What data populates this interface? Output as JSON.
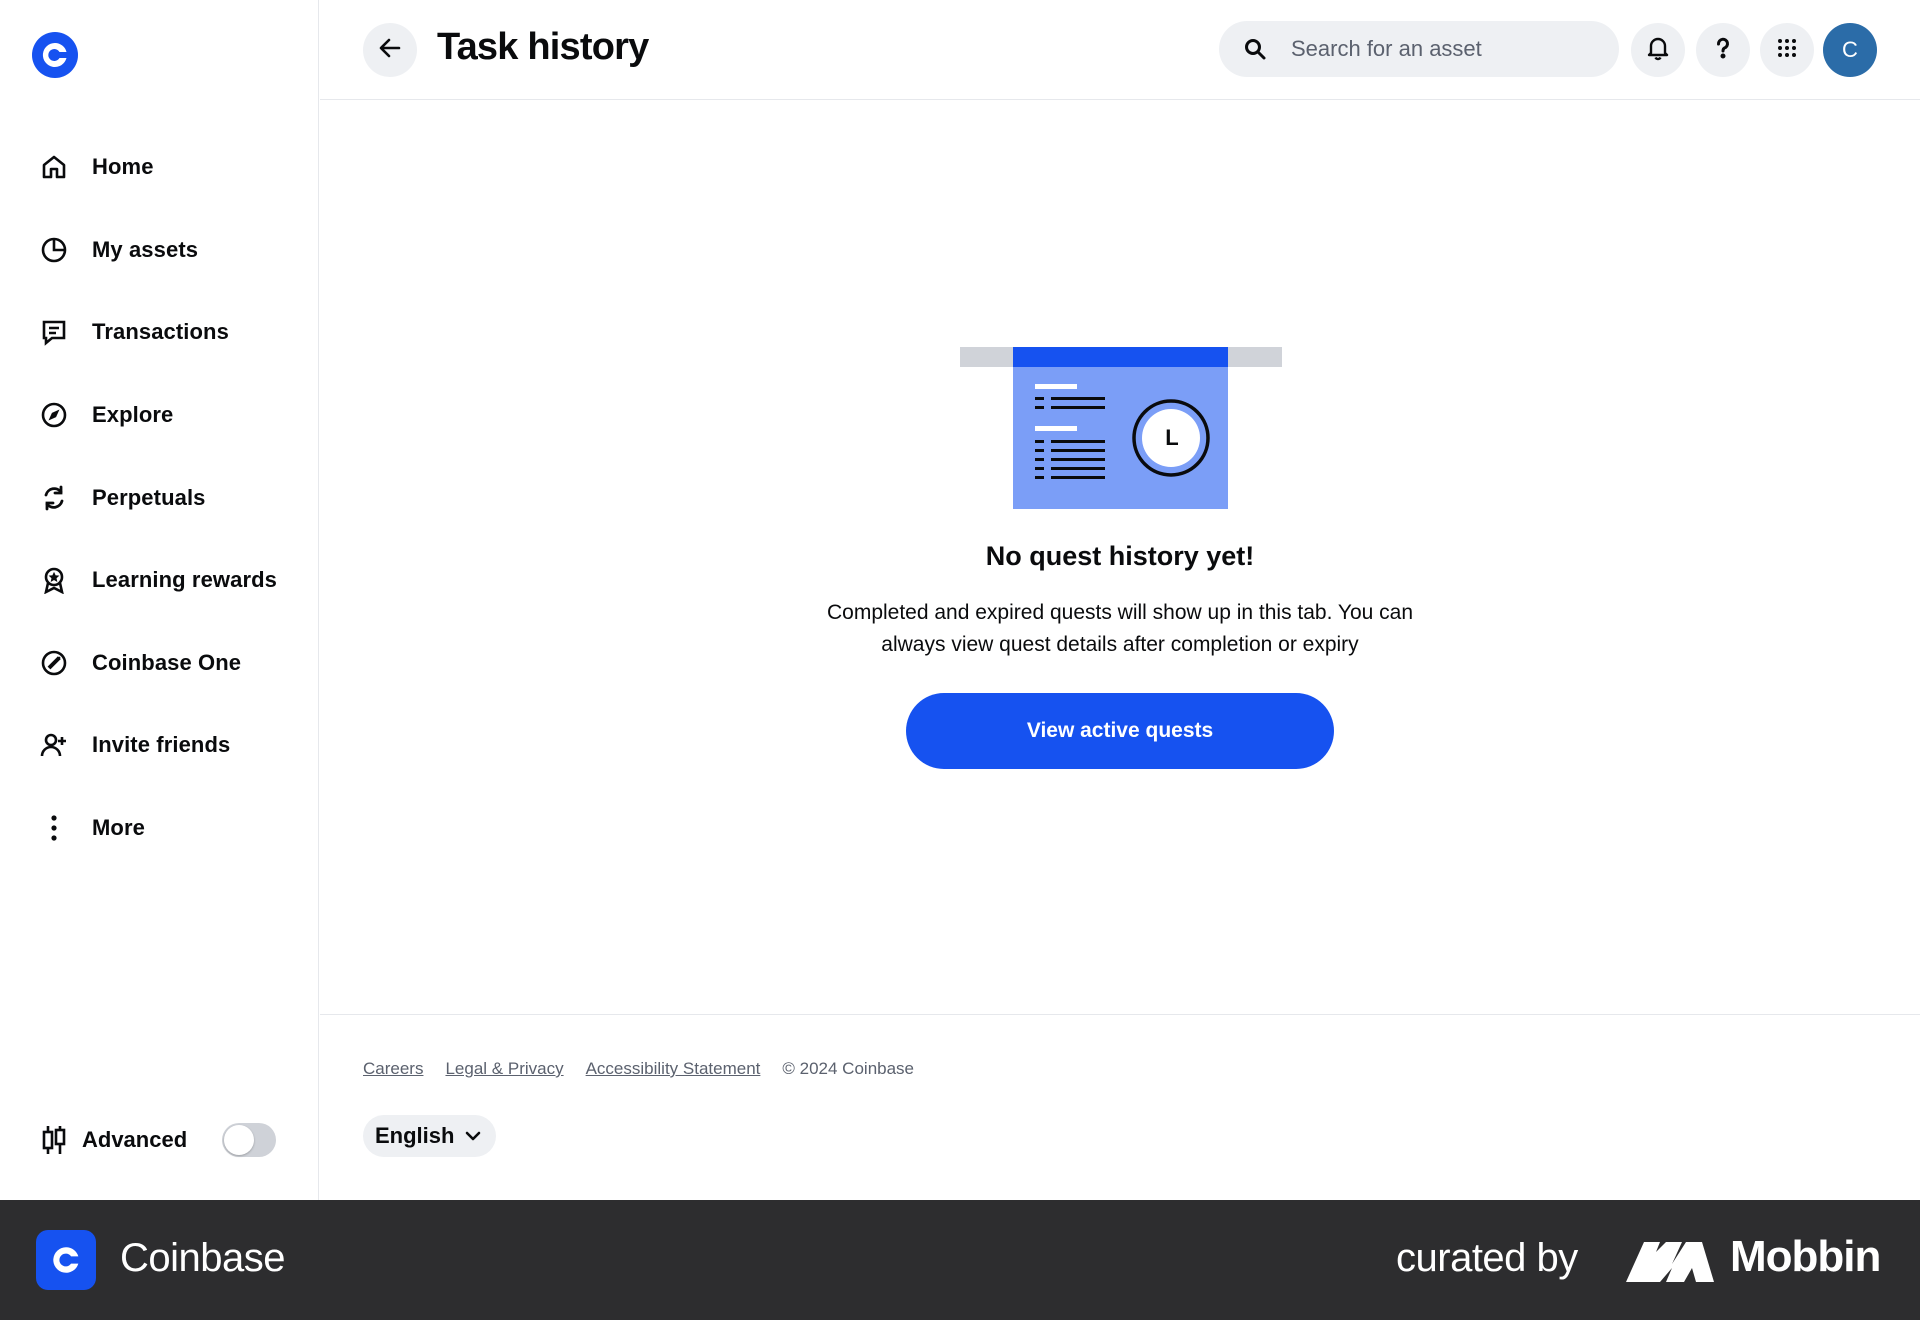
{
  "app": {
    "name": "Coinbase",
    "brand_color": "#1652f0"
  },
  "sidebar": {
    "items": [
      {
        "label": "Home",
        "icon": "home-icon"
      },
      {
        "label": "My assets",
        "icon": "pie-chart-icon"
      },
      {
        "label": "Transactions",
        "icon": "receipt-icon"
      },
      {
        "label": "Explore",
        "icon": "compass-icon"
      },
      {
        "label": "Perpetuals",
        "icon": "refresh-icon"
      },
      {
        "label": "Learning rewards",
        "icon": "reward-badge-icon"
      },
      {
        "label": "Coinbase One",
        "icon": "coinbase-one-icon"
      },
      {
        "label": "Invite friends",
        "icon": "add-user-icon"
      },
      {
        "label": "More",
        "icon": "more-vertical-icon"
      }
    ],
    "advanced": {
      "label": "Advanced",
      "enabled": false
    }
  },
  "header": {
    "title": "Task history",
    "search": {
      "placeholder": "Search for an asset"
    },
    "avatar_initial": "C"
  },
  "main": {
    "illustration": {
      "clock_letter": "L"
    },
    "empty_title": "No quest history yet!",
    "empty_description": "Completed and expired quests will show up in this tab. You can always view quest details after completion or expiry",
    "cta_label": "View active quests"
  },
  "footer": {
    "links": [
      "Careers",
      "Legal & Privacy",
      "Accessibility Statement"
    ],
    "copyright": "© 2024 Coinbase",
    "language": "English"
  },
  "banner": {
    "app_name": "Coinbase",
    "curated_by": "curated by",
    "curator": "Mobbin"
  }
}
